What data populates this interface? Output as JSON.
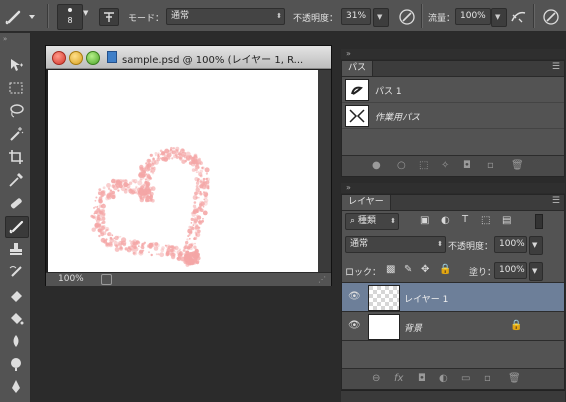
{
  "options_bar": {
    "brush_size": "8",
    "mode_label": "モード：",
    "mode_value": "通常",
    "opacity_label": "不透明度：",
    "opacity_value": "31%",
    "flow_label": "流量：",
    "flow_value": "100%"
  },
  "document": {
    "title": "sample.psd @ 100% (レイヤー 1, R...",
    "zoom": "100%"
  },
  "paths_panel": {
    "tab": "パス",
    "items": [
      {
        "label": "パス 1"
      },
      {
        "label": "作業用パス"
      }
    ]
  },
  "layers_panel": {
    "tab": "レイヤー",
    "filter_kind": "種類",
    "blend_mode": "通常",
    "opacity_label": "不透明度：",
    "opacity_value": "100%",
    "lock_label": "ロック：",
    "fill_label": "塗り：",
    "fill_value": "100%",
    "layers": [
      {
        "name": "レイヤー 1"
      },
      {
        "name": "背景"
      }
    ]
  },
  "colors": {
    "ui_gray": "#535353",
    "selected_layer": "#6d7f99",
    "brush_stroke": "#f4a6a6"
  }
}
